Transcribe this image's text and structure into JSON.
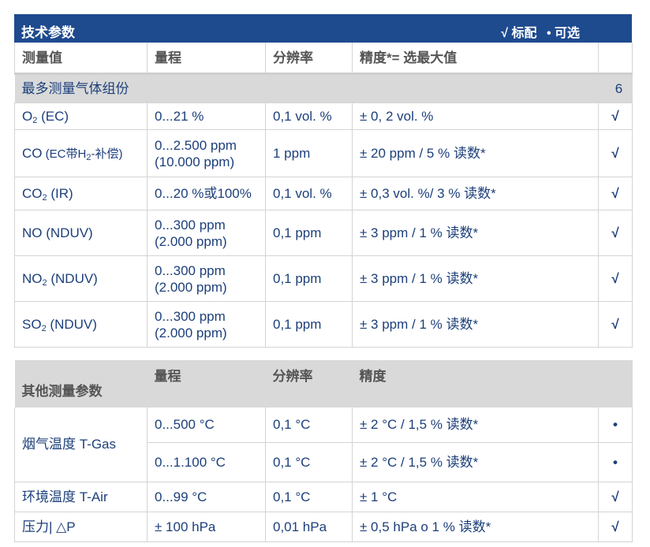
{
  "header": {
    "title": "技术参数",
    "legend_std": "√ 标配",
    "legend_opt": "• 可选"
  },
  "columns": {
    "c1": "测量值",
    "c2": "量程",
    "c3": "分辨率",
    "c4": "精度*= 选最大值"
  },
  "group": {
    "label": "最多测量气体组份",
    "count": "6"
  },
  "gas_rows": [
    {
      "name_main": "O",
      "name_sub": "2",
      "name_tail": " (EC)",
      "range1": "0...21 %",
      "range2": "",
      "res": "0,1 vol. %",
      "acc": "± 0, 2 vol. %",
      "mark": "√"
    },
    {
      "name_main": "CO",
      "name_mid": " (EC带H",
      "name_sub": "2",
      "name_tail": "-补偿)",
      "range1": "0...2.500 ppm",
      "range2": "(10.000 ppm)",
      "res": "1 ppm",
      "acc": "± 20 ppm / 5 % 读数*",
      "mark": "√"
    },
    {
      "name_main": "CO",
      "name_sub": "2",
      "name_tail": " (IR)",
      "range1": "0...20 %或100%",
      "range2": "",
      "res": "0,1 vol. %",
      "acc": "± 0,3 vol. %/ 3 % 读数*",
      "mark": "√"
    },
    {
      "name_main": "NO (NDUV)",
      "range1": "0...300 ppm",
      "range2": "(2.000 ppm)",
      "res": "0,1 ppm",
      "acc": "± 3 ppm / 1 % 读数*",
      "mark": "√"
    },
    {
      "name_main": "NO",
      "name_sub": "2",
      "name_tail": " (NDUV)",
      "range1": "0...300 ppm",
      "range2": "(2.000 ppm)",
      "res": "0,1 ppm",
      "acc": "± 3 ppm / 1 % 读数*",
      "mark": "√"
    },
    {
      "name_main": "SO",
      "name_sub": "2",
      "name_tail": " (NDUV)",
      "range1": "0...300 ppm",
      "range2": "(2.000 ppm)",
      "res": "0,1 ppm",
      "acc": "± 3 ppm / 1 % 读数*",
      "mark": "√"
    }
  ],
  "other_header": {
    "c1": "其他测量参数",
    "c2": "量程",
    "c3": "分辨率",
    "c4": "精度"
  },
  "other": {
    "flue_label": "烟气温度 T-Gas",
    "flue_rows": [
      {
        "range": "0...500 °C",
        "res": "0,1 °C",
        "acc": "± 2 °C / 1,5 % 读数*",
        "mark": "•"
      },
      {
        "range": "0...1.100 °C",
        "res": "0,1 °C",
        "acc": "± 2 °C / 1,5 % 读数*",
        "mark": "•"
      }
    ],
    "air": {
      "label": "环境温度 T-Air",
      "range": "0...99 °C",
      "res": "0,1 °C",
      "acc": "± 1 °C",
      "mark": "√"
    },
    "press": {
      "label": "压力| △P",
      "range": "± 100 hPa",
      "res": "0,01 hPa",
      "acc": "± 0,5 hPa o 1 % 读数*",
      "mark": "√"
    }
  }
}
